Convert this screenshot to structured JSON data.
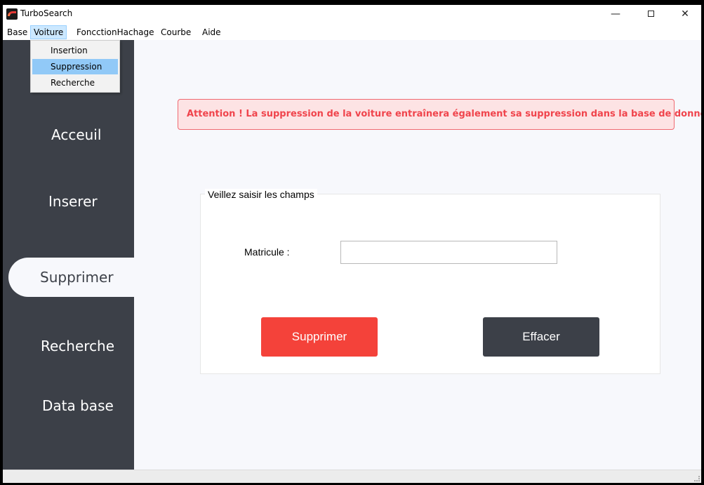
{
  "window": {
    "title": "TurboSearch",
    "controls": {
      "minimize": "—",
      "close": "✕"
    }
  },
  "menubar": {
    "items": [
      "Base",
      "Voiture",
      "FoncctionHachage",
      "Courbe",
      "Aide"
    ],
    "active": "Voiture"
  },
  "dropdown": {
    "items": [
      "Insertion",
      "Suppression",
      "Recherche"
    ],
    "highlighted": "Suppression"
  },
  "sidebar": {
    "items": [
      "Acceuil",
      "Inserer",
      "Supprimer",
      "Recherche",
      "Data base"
    ],
    "active": "Supprimer"
  },
  "alert": {
    "text": "Attention ! La suppression de la voiture entraînera également sa suppression dans la base de données."
  },
  "form": {
    "group_title": "Veillez saisir les champs",
    "matricule_label": "Matricule :",
    "matricule_value": "",
    "delete_label": "Supprimer",
    "clear_label": "Effacer"
  },
  "colors": {
    "sidebar_bg": "#3c4048",
    "content_bg": "#f7f8fc",
    "delete_button": "#f4423a",
    "clear_button": "#3c4048",
    "alert_bg": "#fde3e4",
    "alert_text": "#f0444c",
    "menu_highlight": "#91c9f7"
  }
}
